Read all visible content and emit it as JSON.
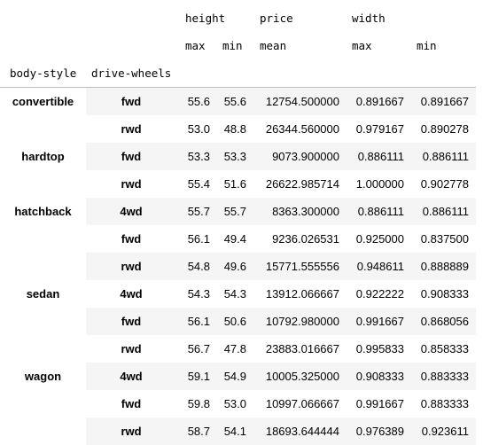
{
  "columns": {
    "level0": [
      "height",
      "price",
      "width"
    ],
    "level1": [
      "max",
      "min",
      "mean",
      "max",
      "min"
    ],
    "index_names": [
      "body-style",
      "drive-wheels"
    ]
  },
  "rows": [
    {
      "group": "convertible",
      "drive": "fwd",
      "h_max": "55.6",
      "h_min": "55.6",
      "p_mean": "12754.500000",
      "w_max": "0.891667",
      "w_min": "0.891667"
    },
    {
      "group": "",
      "drive": "rwd",
      "h_max": "53.0",
      "h_min": "48.8",
      "p_mean": "26344.560000",
      "w_max": "0.979167",
      "w_min": "0.890278"
    },
    {
      "group": "hardtop",
      "drive": "fwd",
      "h_max": "53.3",
      "h_min": "53.3",
      "p_mean": "9073.900000",
      "w_max": "0.886111",
      "w_min": "0.886111"
    },
    {
      "group": "",
      "drive": "rwd",
      "h_max": "55.4",
      "h_min": "51.6",
      "p_mean": "26622.985714",
      "w_max": "1.000000",
      "w_min": "0.902778"
    },
    {
      "group": "hatchback",
      "drive": "4wd",
      "h_max": "55.7",
      "h_min": "55.7",
      "p_mean": "8363.300000",
      "w_max": "0.886111",
      "w_min": "0.886111"
    },
    {
      "group": "",
      "drive": "fwd",
      "h_max": "56.1",
      "h_min": "49.4",
      "p_mean": "9236.026531",
      "w_max": "0.925000",
      "w_min": "0.837500"
    },
    {
      "group": "",
      "drive": "rwd",
      "h_max": "54.8",
      "h_min": "49.6",
      "p_mean": "15771.555556",
      "w_max": "0.948611",
      "w_min": "0.888889"
    },
    {
      "group": "sedan",
      "drive": "4wd",
      "h_max": "54.3",
      "h_min": "54.3",
      "p_mean": "13912.066667",
      "w_max": "0.922222",
      "w_min": "0.908333"
    },
    {
      "group": "",
      "drive": "fwd",
      "h_max": "56.1",
      "h_min": "50.6",
      "p_mean": "10792.980000",
      "w_max": "0.991667",
      "w_min": "0.868056"
    },
    {
      "group": "",
      "drive": "rwd",
      "h_max": "56.7",
      "h_min": "47.8",
      "p_mean": "23883.016667",
      "w_max": "0.995833",
      "w_min": "0.858333"
    },
    {
      "group": "wagon",
      "drive": "4wd",
      "h_max": "59.1",
      "h_min": "54.9",
      "p_mean": "10005.325000",
      "w_max": "0.908333",
      "w_min": "0.883333"
    },
    {
      "group": "",
      "drive": "fwd",
      "h_max": "59.8",
      "h_min": "53.0",
      "p_mean": "10997.066667",
      "w_max": "0.991667",
      "w_min": "0.883333"
    },
    {
      "group": "",
      "drive": "rwd",
      "h_max": "58.7",
      "h_min": "54.1",
      "p_mean": "18693.644444",
      "w_max": "0.976389",
      "w_min": "0.923611"
    }
  ]
}
